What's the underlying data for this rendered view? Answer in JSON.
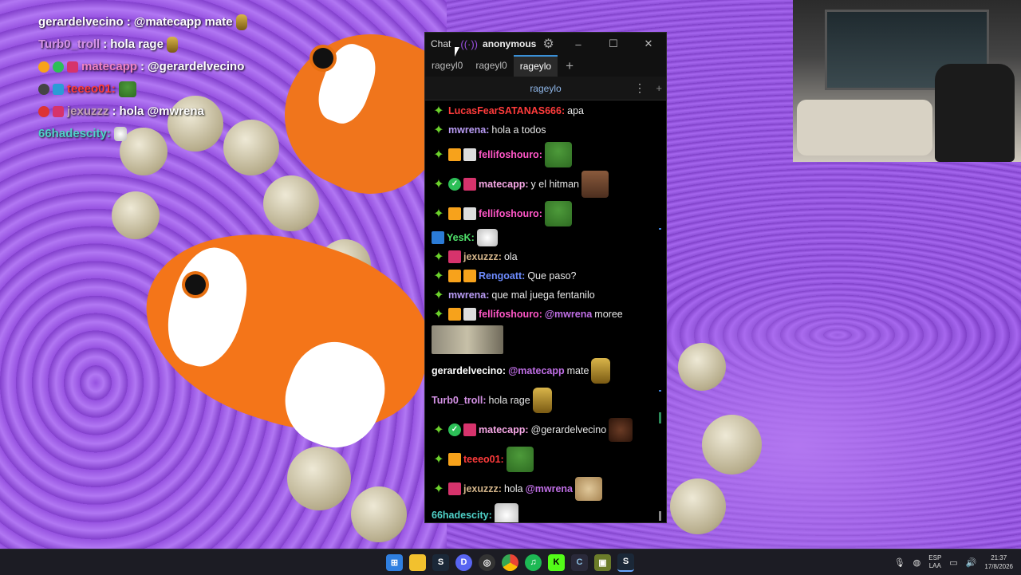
{
  "overlay": [
    {
      "user": "gerardelvecino",
      "color": "#ffffff",
      "text": "@matecapp mate"
    },
    {
      "user": "Turb0_troll",
      "color": "#d592e6",
      "text": "hola rage"
    },
    {
      "user": "matecapp",
      "color": "#f082c4",
      "text": "@gerardelvecino"
    },
    {
      "user": "teeeo01:",
      "color": "#ff3b3b",
      "text": ""
    },
    {
      "user": "jexuzzz",
      "color": "#c3a0b5",
      "text": "hola @mwrena"
    },
    {
      "user": "66hadescity:",
      "color": "#4fd2c9",
      "text": ""
    }
  ],
  "window": {
    "app_title": "Chat",
    "account": "anonymous",
    "minimize": "–",
    "maximize": "☐",
    "close": "✕"
  },
  "tabs": [
    "rageyl0",
    "rageyl0",
    "rageylo"
  ],
  "add_tab": "+",
  "channel": "rageylo",
  "messages": [
    {
      "user": "LucasFearSATANAS666:",
      "color": "#ff3b3b",
      "text": "apa"
    },
    {
      "user": "mwrena:",
      "color": "#b99cf5",
      "text": "hola a todos"
    },
    {
      "user": "fellifoshouro:",
      "color": "#ff57c7",
      "text": ""
    },
    {
      "user": "matecapp:",
      "color": "#f7a8e6",
      "text": "y el hitman"
    },
    {
      "user": "fellifoshouro:",
      "color": "#ff57c7",
      "text": ""
    },
    {
      "user": "YesK:",
      "color": "#4fe06a",
      "text": ""
    },
    {
      "user": "jexuzzz:",
      "color": "#d4b58a",
      "text": "ola"
    },
    {
      "user": "Rengoatt:",
      "color": "#6e8cff",
      "text": "Que paso?"
    },
    {
      "user": "mwrena:",
      "color": "#b99cf5",
      "text": "que mal juega fentanilo"
    },
    {
      "user": "fellifoshouro:",
      "color": "#ff57c7",
      "mention": "@mwrena",
      "text": "moree"
    },
    {
      "user": "gerardelvecino:",
      "color": "#ffffff",
      "mention": "@matecapp",
      "text": "mate"
    },
    {
      "user": "Turb0_troll:",
      "color": "#d592e6",
      "text": "hola rage"
    },
    {
      "user": "matecapp:",
      "color": "#f7a8e6",
      "text": "@gerardelvecino"
    },
    {
      "user": "teeeo01:",
      "color": "#ff3b3b",
      "text": ""
    },
    {
      "user": "jexuzzz:",
      "color": "#d4b58a",
      "text": "hola",
      "mention": "@mwrena"
    },
    {
      "user": "66hadescity:",
      "color": "#4fd2c9",
      "text": ""
    }
  ],
  "tray": {
    "lang_top": "ESP",
    "lang_bottom": "LAA",
    "time": "21:37",
    "date": "17/8/2026"
  }
}
